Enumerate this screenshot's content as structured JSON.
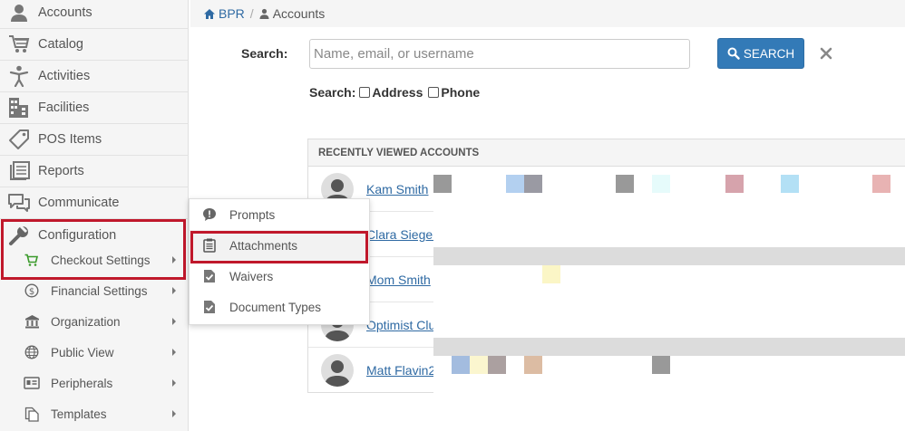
{
  "sidebar": {
    "items": [
      {
        "label": "Accounts",
        "icon": "user-icon"
      },
      {
        "label": "Catalog",
        "icon": "cart-icon"
      },
      {
        "label": "Activities",
        "icon": "person-icon"
      },
      {
        "label": "Facilities",
        "icon": "building-icon"
      },
      {
        "label": "POS Items",
        "icon": "tag-icon"
      },
      {
        "label": "Reports",
        "icon": "reports-icon"
      },
      {
        "label": "Communicate",
        "icon": "chat-icon"
      },
      {
        "label": "Configuration",
        "icon": "wrench-icon"
      }
    ],
    "sub_items": [
      {
        "label": "Checkout Settings",
        "icon": "cart-green-icon"
      },
      {
        "label": "Financial Settings",
        "icon": "dollar-icon"
      },
      {
        "label": "Organization",
        "icon": "bank-icon"
      },
      {
        "label": "Public View",
        "icon": "globe-icon"
      },
      {
        "label": "Peripherals",
        "icon": "id-card-icon"
      },
      {
        "label": "Templates",
        "icon": "documents-icon"
      }
    ]
  },
  "flyout": {
    "items": [
      {
        "label": "Prompts",
        "icon": "exclamation-bubble-icon"
      },
      {
        "label": "Attachments",
        "icon": "clipboard-icon"
      },
      {
        "label": "Waivers",
        "icon": "check-doc-icon"
      },
      {
        "label": "Document Types",
        "icon": "check-doc-icon"
      }
    ]
  },
  "breadcrumb": {
    "home": "BPR",
    "current": "Accounts"
  },
  "search": {
    "label": "Search:",
    "placeholder": "Name, email, or username",
    "button_label": "SEARCH",
    "options_label": "Search:",
    "option_address": "Address",
    "option_phone": "Phone"
  },
  "recent": {
    "header": "RECENTLY VIEWED ACCOUNTS",
    "accounts": [
      "Kam Smith",
      "Clara Siegele",
      "Mom Smith",
      "Optimist Clu",
      "Matt Flavin2"
    ]
  },
  "colors": {
    "highlight": "#c0182b",
    "link": "#2f6aa3",
    "button": "#337ab7",
    "checkout_icon": "#3a9a2a"
  }
}
